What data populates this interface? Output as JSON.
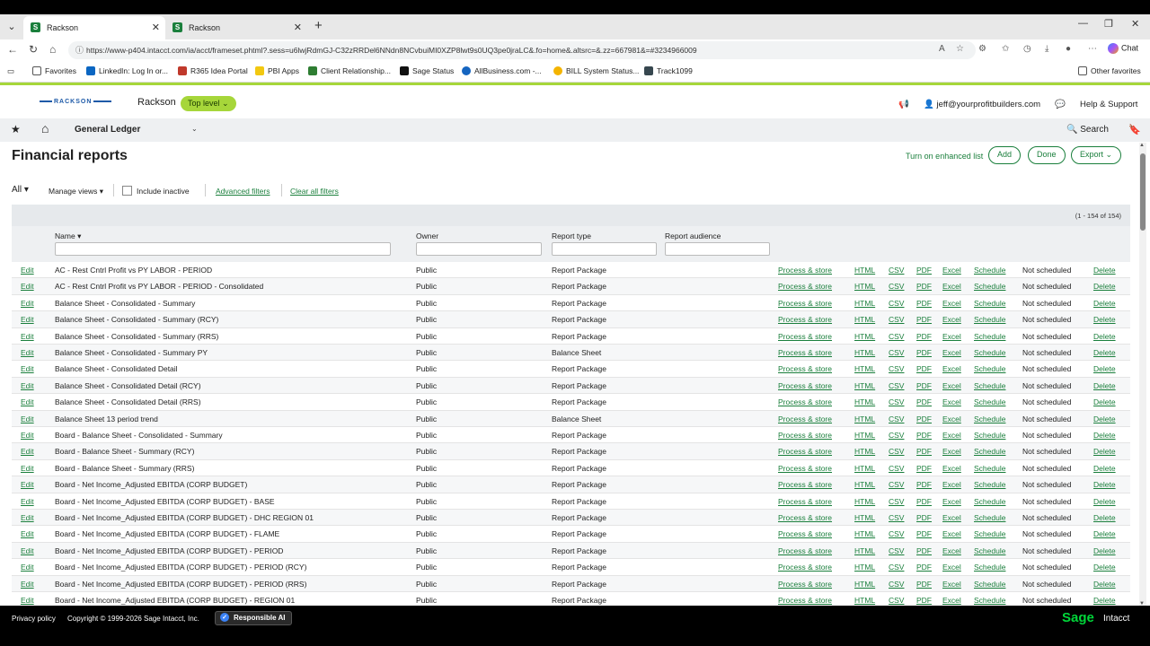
{
  "browser": {
    "tabs": [
      {
        "label": "Rackson",
        "active": true
      },
      {
        "label": "Rackson",
        "active": false
      }
    ],
    "url": "https://www-p404.intacct.com/ia/acct/frameset.phtml?.sess=u6lwjRdmGJ-C32zRRDel6NNdn8NCvbuiMI0XZP8lwt9s0UQ3pe0jraLC&.fo=home&.altsrc=&.zz=667981&=#3234966009",
    "chat_label": "Chat",
    "bookmarks": [
      {
        "label": "Favorites"
      },
      {
        "label": "LinkedIn: Log In or..."
      },
      {
        "label": "R365 Idea Portal"
      },
      {
        "label": "PBI Apps"
      },
      {
        "label": "Client Relationship..."
      },
      {
        "label": "Sage Status"
      },
      {
        "label": "AllBusiness.com -..."
      },
      {
        "label": "BILL System Status..."
      },
      {
        "label": "Track1099"
      }
    ],
    "other_favorites": "Other favorites"
  },
  "header": {
    "logo_text": "RACKSON",
    "company": "Rackson",
    "level": "Top level",
    "user": "jeff@yourprofitbuilders.com",
    "help": "Help & Support"
  },
  "modbar": {
    "module": "General Ledger",
    "search": "Search"
  },
  "page": {
    "title": "Financial reports",
    "enhanced_list": "Turn on enhanced list",
    "add": "Add",
    "done": "Done",
    "export": "Export"
  },
  "filters": {
    "view": "All",
    "manage_views": "Manage views",
    "include_inactive": "Include inactive",
    "advanced": "Advanced filters",
    "clear": "Clear all filters"
  },
  "table": {
    "count": "(1 - 154 of 154)",
    "headers": {
      "name": "Name",
      "owner": "Owner",
      "type": "Report type",
      "audience": "Report audience"
    },
    "actions": {
      "edit": "Edit",
      "process": "Process & store",
      "html": "HTML",
      "csv": "CSV",
      "pdf": "PDF",
      "excel": "Excel",
      "schedule": "Schedule",
      "delete": "Delete"
    },
    "rows": [
      {
        "name": "AC - Rest Cntrl Profit vs PY LABOR - PERIOD",
        "owner": "Public",
        "type": "Report Package",
        "status": "Not scheduled"
      },
      {
        "name": "AC - Rest Cntrl Profit vs PY LABOR - PERIOD - Consolidated",
        "owner": "Public",
        "type": "Report Package",
        "status": "Not scheduled"
      },
      {
        "name": "Balance Sheet - Consolidated - Summary",
        "owner": "Public",
        "type": "Report Package",
        "status": "Not scheduled"
      },
      {
        "name": "Balance Sheet - Consolidated - Summary (RCY)",
        "owner": "Public",
        "type": "Report Package",
        "status": "Not scheduled"
      },
      {
        "name": "Balance Sheet - Consolidated - Summary (RRS)",
        "owner": "Public",
        "type": "Report Package",
        "status": "Not scheduled"
      },
      {
        "name": "Balance Sheet - Consolidated - Summary PY",
        "owner": "Public",
        "type": "Balance Sheet",
        "status": "Not scheduled"
      },
      {
        "name": "Balance Sheet - Consolidated Detail",
        "owner": "Public",
        "type": "Report Package",
        "status": "Not scheduled"
      },
      {
        "name": "Balance Sheet - Consolidated Detail (RCY)",
        "owner": "Public",
        "type": "Report Package",
        "status": "Not scheduled"
      },
      {
        "name": "Balance Sheet - Consolidated Detail (RRS)",
        "owner": "Public",
        "type": "Report Package",
        "status": "Not scheduled"
      },
      {
        "name": "Balance Sheet 13 period trend",
        "owner": "Public",
        "type": "Balance Sheet",
        "status": "Not scheduled"
      },
      {
        "name": "Board - Balance Sheet - Consolidated - Summary",
        "owner": "Public",
        "type": "Report Package",
        "status": "Not scheduled"
      },
      {
        "name": "Board - Balance Sheet - Summary (RCY)",
        "owner": "Public",
        "type": "Report Package",
        "status": "Not scheduled"
      },
      {
        "name": "Board - Balance Sheet - Summary (RRS)",
        "owner": "Public",
        "type": "Report Package",
        "status": "Not scheduled"
      },
      {
        "name": "Board - Net Income_Adjusted EBITDA (CORP BUDGET)",
        "owner": "Public",
        "type": "Report Package",
        "status": "Not scheduled"
      },
      {
        "name": "Board - Net Income_Adjusted EBITDA (CORP BUDGET) - BASE",
        "owner": "Public",
        "type": "Report Package",
        "status": "Not scheduled"
      },
      {
        "name": "Board - Net Income_Adjusted EBITDA (CORP BUDGET) - DHC REGION 01",
        "owner": "Public",
        "type": "Report Package",
        "status": "Not scheduled"
      },
      {
        "name": "Board - Net Income_Adjusted EBITDA (CORP BUDGET) - FLAME",
        "owner": "Public",
        "type": "Report Package",
        "status": "Not scheduled"
      },
      {
        "name": "Board - Net Income_Adjusted EBITDA (CORP BUDGET) - PERIOD",
        "owner": "Public",
        "type": "Report Package",
        "status": "Not scheduled"
      },
      {
        "name": "Board - Net Income_Adjusted EBITDA (CORP BUDGET) - PERIOD (RCY)",
        "owner": "Public",
        "type": "Report Package",
        "status": "Not scheduled"
      },
      {
        "name": "Board - Net Income_Adjusted EBITDA (CORP BUDGET) - PERIOD (RRS)",
        "owner": "Public",
        "type": "Report Package",
        "status": "Not scheduled"
      },
      {
        "name": "Board - Net Income_Adjusted EBITDA (CORP BUDGET) - REGION 01",
        "owner": "Public",
        "type": "Report Package",
        "status": "Not scheduled"
      }
    ]
  },
  "footer": {
    "privacy": "Privacy policy",
    "copyright": "Copyright © 1999-2026 Sage Intacct, Inc.",
    "responsible_ai": "Responsible AI",
    "sage": "Sage",
    "intacct": "Intacct"
  }
}
